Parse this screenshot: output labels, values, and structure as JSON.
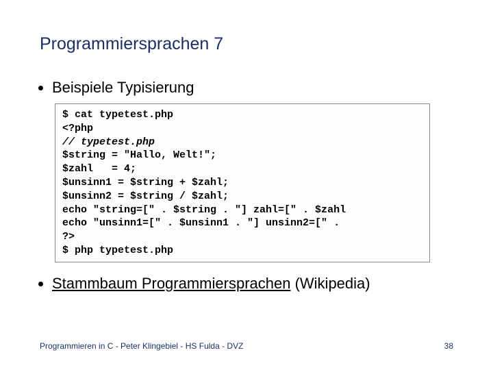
{
  "title": "Programmiersprachen 7",
  "bullet1": "Beispiele Typisierung",
  "code": {
    "l1": "$ cat typetest.php",
    "l2": "<?php",
    "l3": "// typetest.php",
    "l4": "$string = \"Hallo, Welt!\";",
    "l5": "$zahl   = 4;",
    "l6": "$unsinn1 = $string + $zahl;",
    "l7": "$unsinn2 = $string / $zahl;",
    "l8": "echo \"string=[\" . $string . \"] zahl=[\" . $zahl",
    "l9": "echo \"unsinn1=[\" . $unsinn1 . \"] unsinn2=[\" .",
    "l10": "?>",
    "l11": "$ php typetest.php"
  },
  "bullet2_link": "Stammbaum Programmiersprachen",
  "bullet2_suffix": " (Wikipedia)",
  "footer_left": "Programmieren in C - Peter Klingebiel - HS Fulda - DVZ",
  "footer_right": "38"
}
